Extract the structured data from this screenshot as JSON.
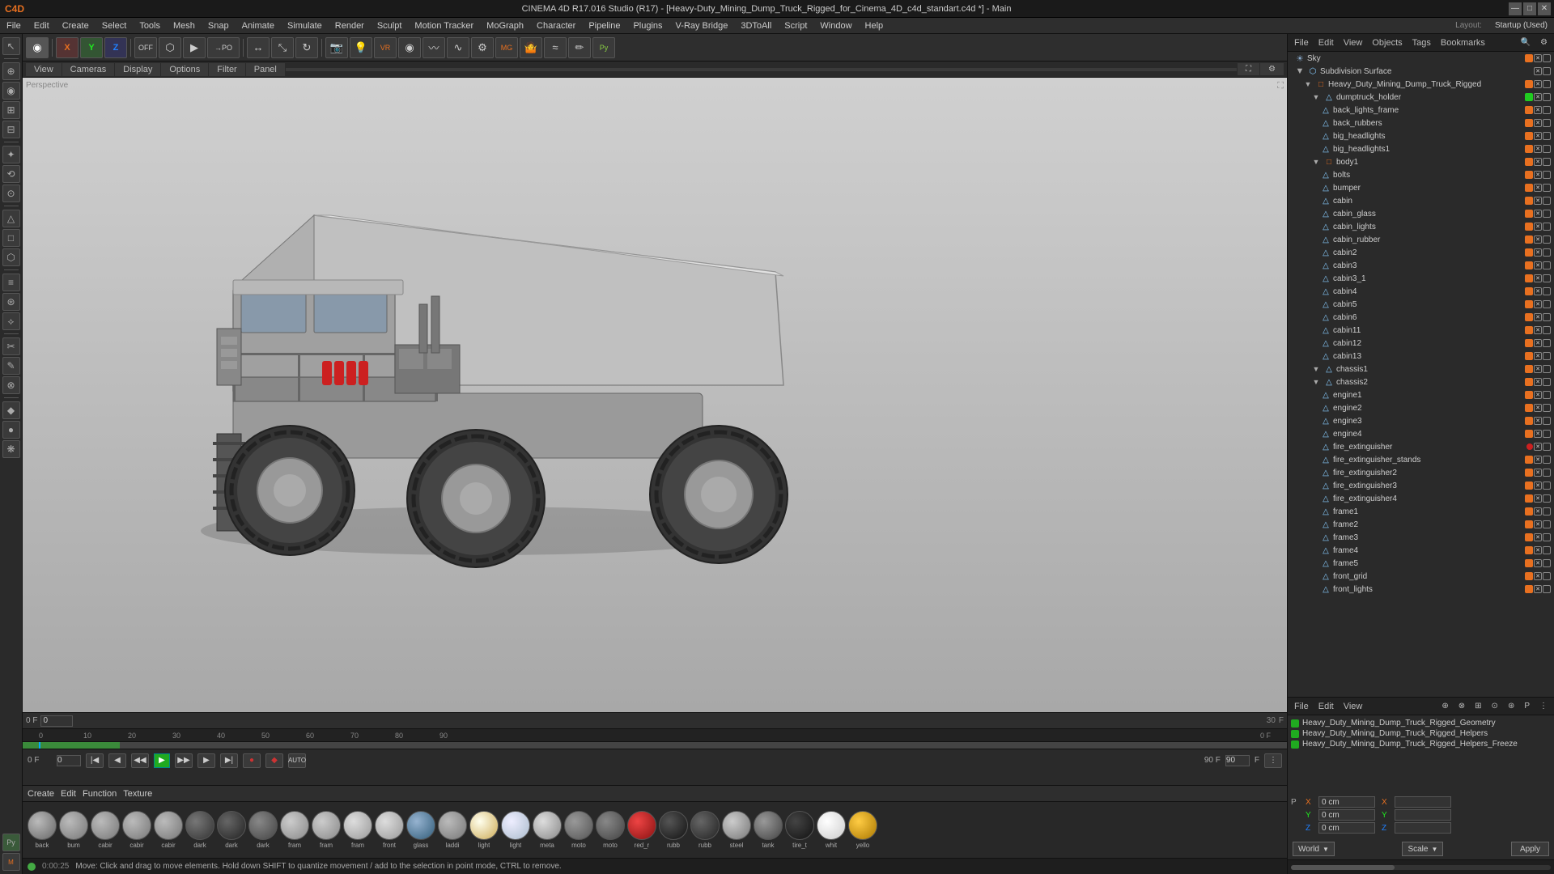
{
  "window": {
    "title": "CINEMA 4D R17.016 Studio (R17) - [Heavy-Duty_Mining_Dump_Truck_Rigged_for_Cinema_4D_c4d_standart.c4d *] - Main"
  },
  "titlebar_controls": [
    "—",
    "□",
    "✕"
  ],
  "menubar": {
    "items": [
      "File",
      "Edit",
      "Create",
      "Select",
      "Tools",
      "Mesh",
      "Snap",
      "Animate",
      "Simulate",
      "Render",
      "Sculpt",
      "Motion Tracker",
      "MoGraph",
      "Character",
      "Pipeline",
      "Plugins",
      "V-Ray Bridge",
      "3DToAll",
      "Script",
      "Window",
      "Help"
    ]
  },
  "layout": {
    "label": "Layout:",
    "value": "Startup (Used)"
  },
  "obj_manager": {
    "header": [
      "File",
      "Edit",
      "View",
      "Objects",
      "Tags",
      "Bookmarks"
    ],
    "items": [
      {
        "name": "Sky",
        "indent": 0,
        "type": "object"
      },
      {
        "name": "Subdivision Surface",
        "indent": 0,
        "type": "subdiv",
        "selected": false
      },
      {
        "name": "Heavy_Duty_Mining_Dump_Truck_Rigged",
        "indent": 1,
        "type": "null"
      },
      {
        "name": "dumptruck_holder",
        "indent": 2,
        "type": "polygon",
        "has_green": true
      },
      {
        "name": "back_lights_frame",
        "indent": 3,
        "type": "polygon"
      },
      {
        "name": "back_rubbers",
        "indent": 3,
        "type": "polygon"
      },
      {
        "name": "big_headlights",
        "indent": 3,
        "type": "polygon"
      },
      {
        "name": "big_headlights1",
        "indent": 3,
        "type": "polygon"
      },
      {
        "name": "body1",
        "indent": 2,
        "type": "null"
      },
      {
        "name": "bolts",
        "indent": 3,
        "type": "polygon"
      },
      {
        "name": "bumper",
        "indent": 3,
        "type": "polygon"
      },
      {
        "name": "cabin",
        "indent": 3,
        "type": "polygon"
      },
      {
        "name": "cabin_glass",
        "indent": 3,
        "type": "polygon"
      },
      {
        "name": "cabin_lights",
        "indent": 3,
        "type": "polygon"
      },
      {
        "name": "cabin_rubber",
        "indent": 3,
        "type": "polygon"
      },
      {
        "name": "cabin2",
        "indent": 3,
        "type": "polygon"
      },
      {
        "name": "cabin3",
        "indent": 3,
        "type": "polygon"
      },
      {
        "name": "cabin3_1",
        "indent": 3,
        "type": "polygon"
      },
      {
        "name": "cabin4",
        "indent": 3,
        "type": "polygon"
      },
      {
        "name": "cabin5",
        "indent": 3,
        "type": "polygon"
      },
      {
        "name": "cabin6",
        "indent": 3,
        "type": "polygon"
      },
      {
        "name": "cabin11",
        "indent": 3,
        "type": "polygon"
      },
      {
        "name": "cabin12",
        "indent": 3,
        "type": "polygon"
      },
      {
        "name": "cabin13",
        "indent": 3,
        "type": "polygon"
      },
      {
        "name": "chassis1",
        "indent": 3,
        "type": "polygon"
      },
      {
        "name": "chassis2",
        "indent": 3,
        "type": "polygon"
      },
      {
        "name": "engine1",
        "indent": 3,
        "type": "polygon"
      },
      {
        "name": "engine2",
        "indent": 3,
        "type": "polygon"
      },
      {
        "name": "engine3",
        "indent": 3,
        "type": "polygon"
      },
      {
        "name": "engine4",
        "indent": 3,
        "type": "polygon"
      },
      {
        "name": "fire_extinguisher",
        "indent": 3,
        "type": "polygon"
      },
      {
        "name": "fire_extinguisher_stands",
        "indent": 3,
        "type": "polygon"
      },
      {
        "name": "fire_extinguisher2",
        "indent": 3,
        "type": "polygon"
      },
      {
        "name": "fire_extinguisher3",
        "indent": 3,
        "type": "polygon"
      },
      {
        "name": "fire_extinguisher4",
        "indent": 3,
        "type": "polygon"
      },
      {
        "name": "frame1",
        "indent": 3,
        "type": "polygon"
      },
      {
        "name": "frame2",
        "indent": 3,
        "type": "polygon"
      },
      {
        "name": "frame3",
        "indent": 3,
        "type": "polygon"
      },
      {
        "name": "frame4",
        "indent": 3,
        "type": "polygon"
      },
      {
        "name": "frame5",
        "indent": 3,
        "type": "polygon"
      },
      {
        "name": "front_grid",
        "indent": 3,
        "type": "polygon"
      },
      {
        "name": "front_lights",
        "indent": 3,
        "type": "polygon"
      }
    ]
  },
  "viewport": {
    "tabs": [
      "View",
      "Cameras",
      "Display",
      "Options",
      "Filter",
      "Panel"
    ]
  },
  "toolbar": {
    "icons": [
      "↺",
      "→",
      "↗",
      "⊕",
      "⊗",
      "◉",
      "□",
      "○",
      "△",
      "⬡",
      "⊞",
      "⊟",
      "⟲",
      "⟳",
      "✦",
      "⊙",
      "⊛",
      "⟡"
    ]
  },
  "timeline": {
    "start": 0,
    "end": 90,
    "current": 0,
    "fps": 30,
    "ticks": [
      0,
      10,
      20,
      30,
      40,
      50,
      60,
      70,
      80,
      90
    ],
    "end_label": "0 F",
    "current_display": "0 F",
    "end_frame": "90 F"
  },
  "material_bar": {
    "menus": [
      "Create",
      "Edit",
      "Function",
      "Texture"
    ],
    "materials": [
      {
        "name": "back",
        "color": "#888",
        "type": "grey"
      },
      {
        "name": "bum",
        "color": "#888",
        "type": "grey"
      },
      {
        "name": "cabir",
        "color": "#888",
        "type": "grey"
      },
      {
        "name": "cabir",
        "color": "#888",
        "type": "grey"
      },
      {
        "name": "cabir",
        "color": "#888",
        "type": "grey"
      },
      {
        "name": "dark",
        "color": "#444",
        "type": "dark"
      },
      {
        "name": "dark",
        "color": "#333",
        "type": "dark"
      },
      {
        "name": "dark",
        "color": "#555",
        "type": "dark"
      },
      {
        "name": "fram",
        "color": "#999",
        "type": "grey"
      },
      {
        "name": "fram",
        "color": "#999",
        "type": "grey"
      },
      {
        "name": "fram",
        "color": "#aaa",
        "type": "grey"
      },
      {
        "name": "front",
        "color": "#aaa",
        "type": "grey"
      },
      {
        "name": "glass",
        "color": "#88aacc",
        "type": "blue"
      },
      {
        "name": "laddi",
        "color": "#888",
        "type": "grey"
      },
      {
        "name": "light",
        "color": "#eeddaa",
        "type": "light"
      },
      {
        "name": "light",
        "color": "#ddeeff",
        "type": "light"
      },
      {
        "name": "meta",
        "color": "#aaaaaa",
        "type": "metal"
      },
      {
        "name": "moto",
        "color": "#666",
        "type": "dark"
      },
      {
        "name": "moto",
        "color": "#555",
        "type": "dark"
      },
      {
        "name": "red_r",
        "color": "#cc3333",
        "type": "red"
      },
      {
        "name": "rubb",
        "color": "#333",
        "type": "dark"
      },
      {
        "name": "rubb",
        "color": "#444",
        "type": "dark"
      },
      {
        "name": "steel",
        "color": "#888",
        "type": "metal"
      },
      {
        "name": "tank",
        "color": "#666",
        "type": "dark"
      },
      {
        "name": "tire_t",
        "color": "#222",
        "type": "dark"
      },
      {
        "name": "whit",
        "color": "#eeeeee",
        "type": "white"
      },
      {
        "name": "yello",
        "color": "#ddaa22",
        "type": "yellow"
      }
    ]
  },
  "attr_manager": {
    "header": [
      "File",
      "Edit",
      "View"
    ],
    "selected_objects": [
      "Heavy_Duty_Mining_Dump_Truck_Rigged_Geometry",
      "Heavy_Duty_Mining_Dump_Truck_Rigged_Helpers",
      "Heavy_Duty_Mining_Dump_Truck_Rigged_Helpers_Freeze"
    ],
    "coords": {
      "position": {
        "x": "0 cm",
        "y": "0 cm",
        "z": "0 cm"
      },
      "rotation": {
        "x": "",
        "y": "",
        "z": ""
      },
      "scale": {
        "x": "",
        "y": "",
        "z": ""
      }
    },
    "world_label": "World",
    "apply_label": "Apply"
  },
  "status": {
    "time": "0:00:25",
    "message": "Move: Click and drag to move elements. Hold down SHIFT to quantize movement / add to the selection in point mode, CTRL to remove."
  }
}
